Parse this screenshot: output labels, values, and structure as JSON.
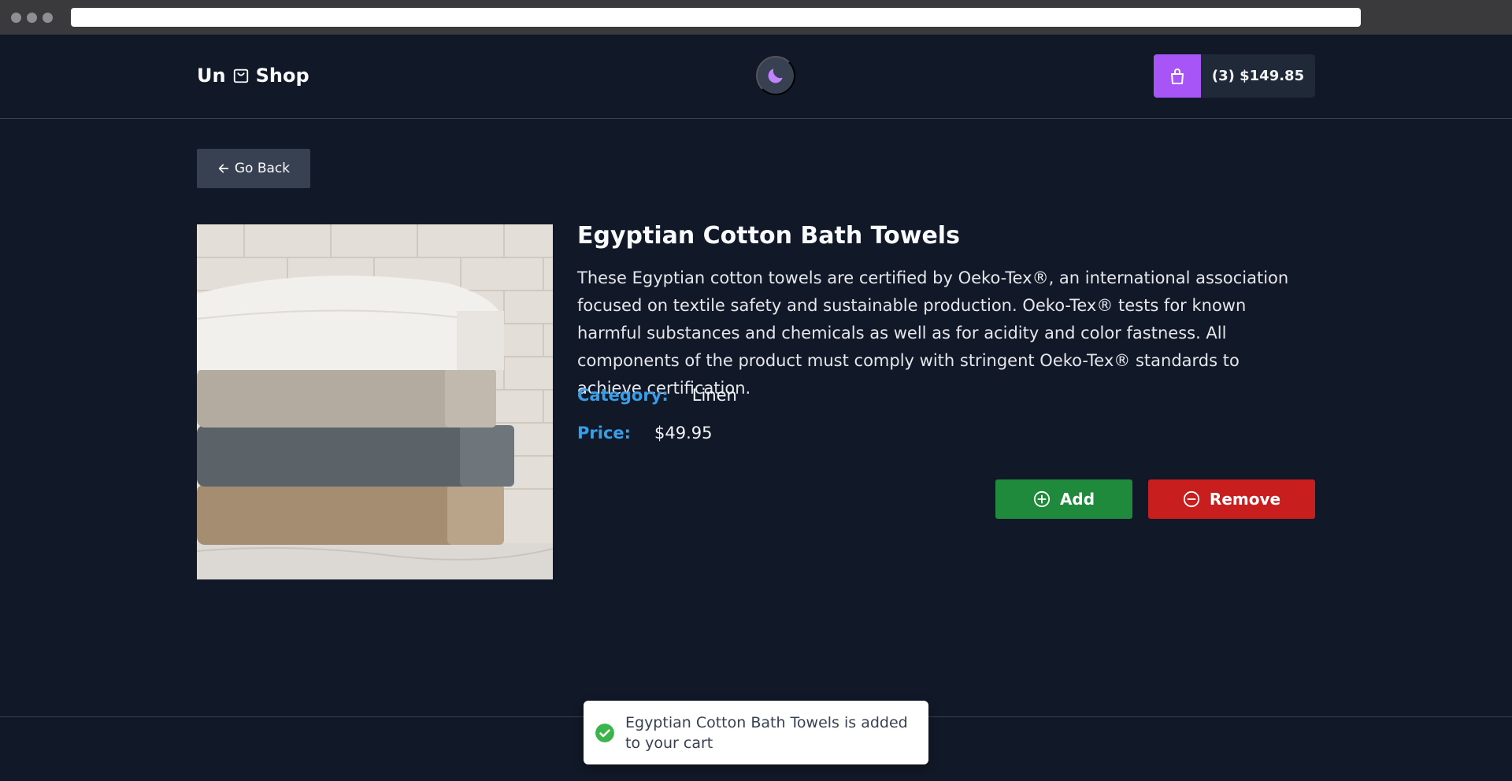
{
  "header": {
    "logo_left": "Un",
    "logo_right": "Shop",
    "cart_label": "(3) $149.85",
    "colors": {
      "cart_accent": "#a855f7",
      "moon": "#c084fc"
    }
  },
  "nav": {
    "go_back_label": "Go Back"
  },
  "product": {
    "title": "Egyptian Cotton Bath Towels",
    "description": "These Egyptian cotton towels are certified by Oeko-Tex®, an international association focused on textile safety and sustainable production. Oeko-Tex® tests for known harmful substances and chemicals as well as for acidity and color fastness. All components of the product must comply with stringent Oeko-Tex® standards to achieve certification.",
    "category_label": "Category:",
    "category_value": "Linen",
    "price_label": "Price:",
    "price_value": "$49.95",
    "image_icon": "towel-stack-photo"
  },
  "actions": {
    "add_label": "Add",
    "remove_label": "Remove",
    "colors": {
      "add": "#1f8a3c",
      "remove": "#c81e1e",
      "label_accent": "#3b9de3"
    }
  },
  "toast": {
    "message": "Egyptian Cotton Bath Towels is added to your cart",
    "icon": "check-circle-icon",
    "color": "#3bb54a"
  }
}
